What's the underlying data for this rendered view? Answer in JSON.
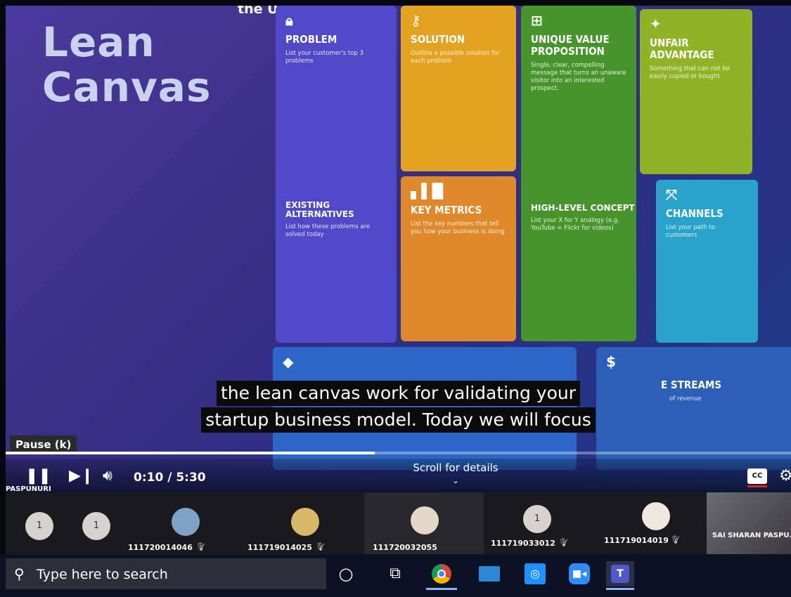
{
  "slide": {
    "title_line1": "Lean",
    "title_line2": "Canvas",
    "top_fragment": "the Uber example",
    "cards": {
      "problem": {
        "title": "PROBLEM",
        "desc": "List your customer's top 3 problems"
      },
      "solution": {
        "title": "SOLUTION",
        "desc": "Outline a possible solution for each problem"
      },
      "uvp": {
        "title": "UNIQUE VALUE PROPOSITION",
        "desc": "Single, clear, compelling message that turns an unaware visitor into an interested prospect."
      },
      "unfair": {
        "title": "UNFAIR ADVANTAGE",
        "desc": "Something that can not be easily copied or bought"
      },
      "existing": {
        "title": "EXISTING ALTERNATIVES",
        "desc": "List how these problems are solved today"
      },
      "key_metrics": {
        "title": "KEY METRICS",
        "desc": "List the key numbers that tell you how your business is doing"
      },
      "high_level": {
        "title": "HIGH-LEVEL CONCEPT",
        "desc": "List your X for Y analogy (e.g. YouTube = Flickr for videos)"
      },
      "channels": {
        "title": "CHANNELS",
        "desc": "List your path to customers"
      },
      "revenue": {
        "title": "E STREAMS",
        "desc": "of revenue"
      }
    }
  },
  "captions": {
    "line1": "the lean canvas work for validating your",
    "line2": "startup business model. Today we will focus"
  },
  "player": {
    "tooltip": "Pause (k)",
    "time": "0:10 / 5:30",
    "progress_fraction": 0.47,
    "scroll_details": "Scroll for details",
    "cc_label": "CC",
    "overlay_name": "PASPUNURI"
  },
  "participants": [
    {
      "type": "badge",
      "label": "1"
    },
    {
      "type": "badge",
      "label": "1"
    },
    {
      "type": "avatar",
      "name": "111720014046",
      "muted": true,
      "color": "#7fa2c9"
    },
    {
      "type": "avatar",
      "name": "111719014025",
      "muted": true,
      "color": "#d9b86a"
    },
    {
      "type": "avatar",
      "name": "111720032055",
      "muted": false,
      "color": "#e4d9c8"
    },
    {
      "type": "badge-named",
      "label": "1",
      "name": "111719033012",
      "muted": true
    },
    {
      "type": "avatar",
      "name": "111719014019",
      "muted": true,
      "color": "#efe6dd"
    },
    {
      "type": "video",
      "name": "SAI SHARAN PASPU..."
    }
  ],
  "taskbar": {
    "search_placeholder": "Type here to search",
    "icons": [
      "cortana-icon",
      "task-view-icon",
      "chrome-icon",
      "mail-icon",
      "camera-icon",
      "zoom-icon",
      "teams-icon"
    ]
  }
}
